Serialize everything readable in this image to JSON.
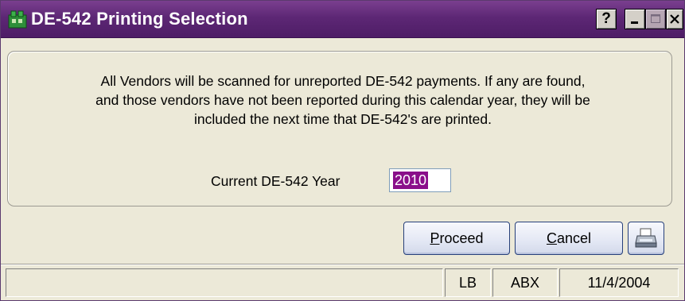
{
  "window": {
    "title": "DE-542 Printing Selection",
    "icon": "app-icon",
    "controls": {
      "help": "?",
      "minimize": "minimize-icon",
      "maximize": "maximize-icon",
      "close": "close-icon"
    }
  },
  "message": "All Vendors will be scanned for unreported DE-542 payments.  If any are found,\nand those vendors have not been reported during this calendar year, they will be\nincluded the next time that DE-542's are printed.",
  "year_field": {
    "label": "Current DE-542 Year",
    "value": "2010"
  },
  "buttons": {
    "proceed": {
      "underlined": "P",
      "rest": "roceed"
    },
    "cancel": {
      "underlined": "C",
      "rest": "ancel"
    },
    "print_icon": "printer-icon"
  },
  "status_bar": {
    "message": "",
    "user": "LB",
    "company": "ABX",
    "date": "11/4/2004"
  },
  "colors": {
    "title_bar": "#5d2775",
    "selection": "#8a0f8a",
    "button_border": "#27407a"
  }
}
